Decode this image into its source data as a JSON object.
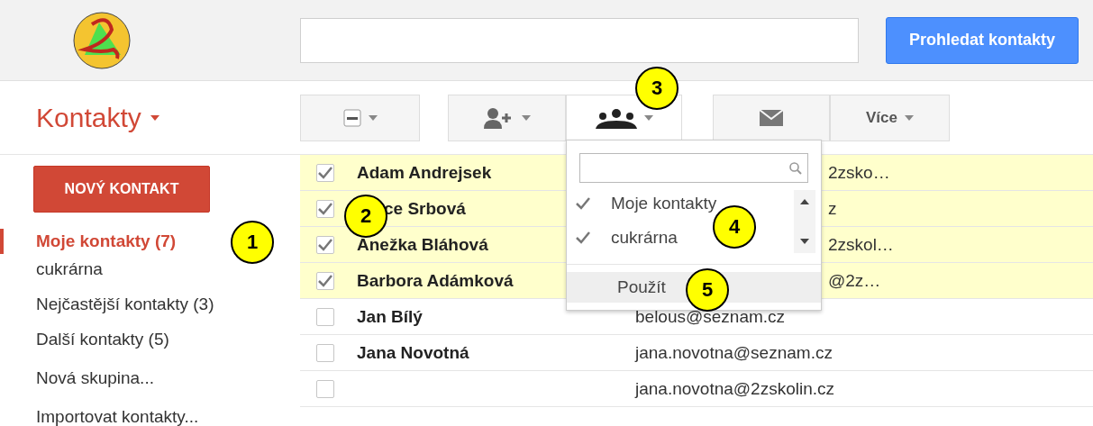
{
  "header": {
    "search_button": "Prohledat kontakty"
  },
  "app_title": "Kontakty",
  "toolbar": {
    "more_button": "Více"
  },
  "sidebar": {
    "new_button": "NOVÝ KONTAKT",
    "items": [
      {
        "label": "Moje kontakty (7)",
        "selected": true,
        "kind": "group"
      },
      {
        "label": "cukrárna",
        "selected": false,
        "kind": "subgroup"
      },
      {
        "label": "Nejčastější kontakty (3)",
        "selected": false,
        "kind": "group"
      },
      {
        "label": "Další kontakty (5)",
        "selected": false,
        "kind": "group"
      },
      {
        "label": "Nová skupina...",
        "selected": false,
        "kind": "action"
      },
      {
        "label": "Importovat kontakty...",
        "selected": false,
        "kind": "action"
      }
    ]
  },
  "contacts": [
    {
      "name": {
        "text": "Adam Andrejsek",
        "kind": "full"
      },
      "email": {
        "text": "2zsko…",
        "kind": "partial"
      },
      "selected": true
    },
    {
      "name": {
        "text": "ce Srbová",
        "kind": "partial"
      },
      "email": {
        "text": "z",
        "kind": "partial"
      },
      "selected": true
    },
    {
      "name": {
        "text": "Anežka Bláhová",
        "kind": "full"
      },
      "email": {
        "text": "2zskol…",
        "kind": "partial"
      },
      "selected": true
    },
    {
      "name": {
        "text": "Barbora Adámková",
        "kind": "full"
      },
      "email": {
        "text": "@2z…",
        "kind": "partial"
      },
      "selected": true
    },
    {
      "name": {
        "text": "Jan Bílý",
        "kind": "full"
      },
      "email": {
        "text": "belous@seznam.cz",
        "kind": "full"
      },
      "selected": false
    },
    {
      "name": {
        "text": "Jana Novotná",
        "kind": "full"
      },
      "email": {
        "text": "jana.novotna@seznam.cz",
        "kind": "full"
      },
      "selected": false
    },
    {
      "email": {
        "text": "jana.novotna@2zskolin.cz",
        "kind": "full"
      },
      "selected": false
    }
  ],
  "group_menu": {
    "items": [
      {
        "label": "Moje kontakty",
        "checked": true
      },
      {
        "label": "cukrárna",
        "checked": true
      }
    ],
    "apply": "Použít"
  },
  "callouts": [
    {
      "label": "1"
    },
    {
      "label": "2"
    },
    {
      "label": "3"
    },
    {
      "label": "4"
    },
    {
      "label": "5"
    }
  ]
}
